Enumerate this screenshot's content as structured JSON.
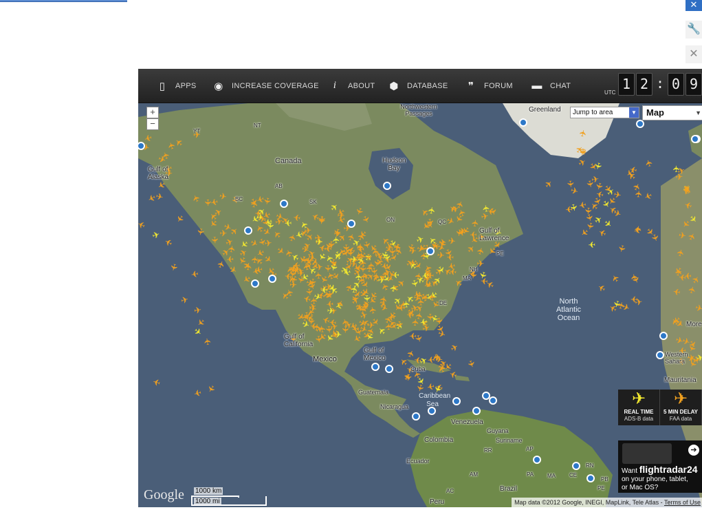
{
  "browser": {
    "close_glyph": "✕",
    "wrench_glyph": "🔧",
    "close_gray_glyph": "✕"
  },
  "nav": {
    "items": [
      {
        "label": "APPS",
        "icon": "phone-icon",
        "glyph": "▯"
      },
      {
        "label": "INCREASE COVERAGE",
        "icon": "eye-icon",
        "glyph": "◉"
      },
      {
        "label": "ABOUT",
        "icon": "info-icon",
        "glyph": "i"
      },
      {
        "label": "DATABASE",
        "icon": "box-icon",
        "glyph": "⬢"
      },
      {
        "label": "FORUM",
        "icon": "quote-icon",
        "glyph": "❞"
      },
      {
        "label": "CHAT",
        "icon": "speech-bubble-icon",
        "glyph": "▬"
      }
    ],
    "utc_label": "UTC",
    "clock": {
      "h1": "1",
      "h2": "2",
      "sep": ":",
      "m1": "0",
      "m2": "9"
    }
  },
  "map": {
    "zoom_in": "+",
    "zoom_out": "−",
    "jump_to_area": "Jump to area",
    "map_type": "Map",
    "labels": {
      "greenland": "Greenland",
      "northwestern_passages": "Northwestern Passages",
      "hudson_bay": "Hudson Bay",
      "gulf_of_alaska": "Gulf of Alaska",
      "canada": "Canada",
      "yt": "YT",
      "nt": "NT",
      "bc": "BC",
      "ab": "AB",
      "sk": "SK",
      "on": "ON",
      "qc": "QC",
      "nl": "NL",
      "pe": "PE",
      "nh": "NH",
      "ma": "MA",
      "de": "DE",
      "gulf_of_st_lawrence": "Gulf of Lawrence",
      "north_atlantic_ocean": "North Atlantic Ocean",
      "gulf_of_california": "Gulf of California",
      "mexico": "Mexico",
      "gulf_of_mexico": "Gulf of Mexico",
      "cuba": "Cuba",
      "guatemala": "Guatemala",
      "nicaragua": "Nicaragua",
      "caribbean_sea": "Caribbean Sea",
      "venezuela": "Venezuela",
      "guyana": "Guyana",
      "suriname": "Suriname",
      "colombia": "Colombia",
      "ecuador": "Ecuador",
      "brazil": "Brazil",
      "peru": "Peru",
      "rr": "RR",
      "ap": "AP",
      "am": "AM",
      "pa": "PA",
      "ma_br": "MA",
      "ce": "CE",
      "rn": "RN",
      "pb": "PB",
      "pe_br": "PE",
      "ac": "AC",
      "western_sahara": "Western Sahara",
      "mauritania": "Mauritania",
      "morocco": "More"
    },
    "scale_km": "1000 km",
    "scale_mi": "1000 mi",
    "google": "Google",
    "attribution": "Map data ©2012 Google, INEGI, MapLink, Tele Atlas - ",
    "terms": "Terms of Use"
  },
  "legend": {
    "realtime_title": "REAL TIME",
    "realtime_sub": "ADS-B data",
    "delay_title": "5 MIN DELAY",
    "delay_sub": "FAA data"
  },
  "promo": {
    "line1_prefix": "Want ",
    "brand": "flightradar24",
    "line2": "on your phone, tablet,",
    "line3": "or Mac OS?"
  },
  "colors": {
    "ocean": "#4a5e78",
    "land": "#7b8a5f",
    "plane_faa": "#f0a020",
    "plane_adsb": "#f2e830",
    "navbar": "#2a2a2a"
  }
}
